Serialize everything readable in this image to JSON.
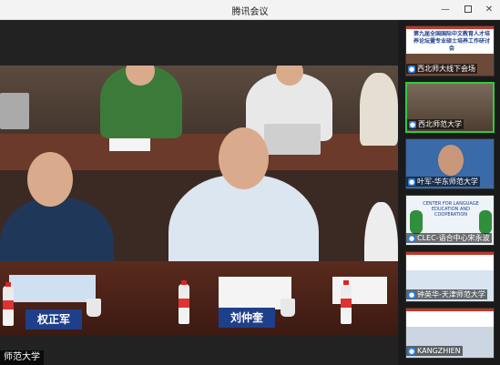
{
  "window": {
    "title": "腾讯会议"
  },
  "main": {
    "nameplates": [
      "权正军",
      "刘仲奎"
    ],
    "subtitle": "师范大学"
  },
  "sidebar": {
    "thumbs": [
      {
        "label": "西北师大线下会场",
        "banner": "第九届全国国际中文教育人才培养论坛暨专业硕士培养工作研讨会"
      },
      {
        "label": "西北师范大学"
      },
      {
        "label": "叶军-华东师范大学"
      },
      {
        "label": "CLEC-语合中心宋永波",
        "banner": "CENTER FOR LANGUAGE EDUCATION AND COOPERATION"
      },
      {
        "label": "钟英华-天津师范大学"
      },
      {
        "label": "KANGZHIEN"
      }
    ]
  },
  "colors": {
    "active_border": "#2ecc40",
    "nameplate": "#1e3f8a"
  }
}
